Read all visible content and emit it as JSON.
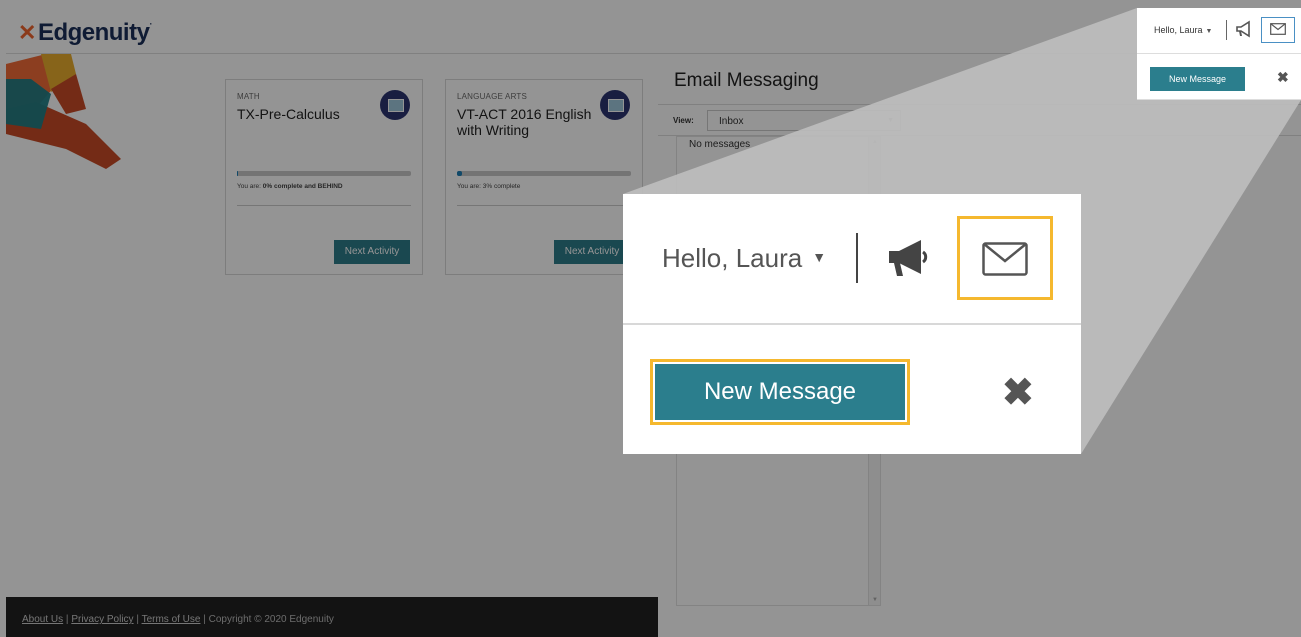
{
  "header": {
    "logo_text": "Edgenuity",
    "logo_mark": "✕"
  },
  "courses": [
    {
      "subject": "MATH",
      "title": "TX-Pre-Calculus",
      "progress_percent": 0,
      "status_prefix": "You are: ",
      "status_strong": "0% complete and BEHIND",
      "button": "Next Activity"
    },
    {
      "subject": "LANGUAGE ARTS",
      "title": "VT-ACT 2016 English with Writing",
      "progress_percent": 3,
      "status_prefix": "You are: ",
      "status_strong": "3% complete",
      "button": "Next Activity"
    }
  ],
  "footer": {
    "about": "About Us",
    "privacy": "Privacy Policy",
    "terms": "Terms of Use",
    "sep": "|",
    "copyright": "Copyright © 2020 Edgenuity"
  },
  "email": {
    "title": "Email Messaging",
    "view_label": "View:",
    "view_value": "Inbox",
    "empty_text": "No messages"
  },
  "user_menu": {
    "greeting": "Hello, Laura",
    "new_message": "New Message"
  },
  "icons": {
    "announcements": "megaphone-icon",
    "mail": "envelope-icon",
    "close": "close-icon",
    "dropdown": "caret-down-icon"
  },
  "colors": {
    "accent_teal": "#2b7e8d",
    "highlight": "#f5b82e",
    "brand_navy": "#1b2f5a",
    "brand_orange": "#f0642d"
  }
}
